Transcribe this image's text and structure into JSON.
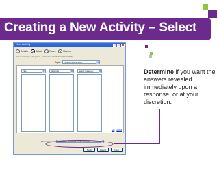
{
  "slide": {
    "title": "Creating a New Activity – Select",
    "accent": "#6c2a8c",
    "accent_secondary": "#8ec63f"
  },
  "window": {
    "title": "New Activity",
    "steps": [
      {
        "num": "1",
        "label": "Details"
      },
      {
        "num": "2",
        "label": "Select"
      },
      {
        "num": "3",
        "label": "Rules"
      },
      {
        "num": "4",
        "label": "Review"
      }
    ],
    "instruction": "Select the topic, categories, and items to include in this activity",
    "topic_label": "Topic:",
    "topic_value": "Period Classification",
    "columns": [
      {
        "select_value": "Title"
      },
      {
        "select_value": "Materials"
      },
      {
        "select_value": "Select Category"
      }
    ],
    "side_links": [
      "Add",
      "Add all"
    ],
    "response_label": "Show answers:",
    "response_value": "Immediately following a student response",
    "buttons": [
      "Back",
      "Cancel",
      "Next"
    ]
  },
  "callout": {
    "strong": "Determine",
    "text": " if you want the answers revealed immediately upon a response, or at your discretion."
  }
}
